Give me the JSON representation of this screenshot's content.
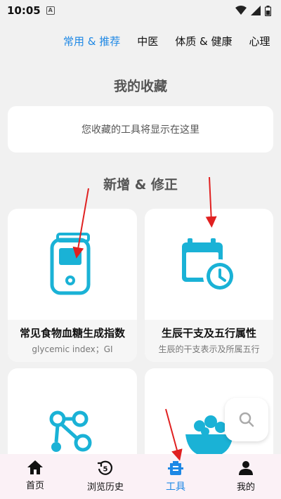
{
  "status_bar": {
    "time": "10:05",
    "a_badge": "A"
  },
  "tabs": [
    {
      "label": "常用 & 推荐",
      "active": true
    },
    {
      "label": "中医",
      "active": false
    },
    {
      "label": "体质 & 健康",
      "active": false
    },
    {
      "label": "心理",
      "active": false
    }
  ],
  "favorites": {
    "title": "我的收藏",
    "empty_text": "您收藏的工具将显示在这里"
  },
  "updates": {
    "title": "新增 & 修正",
    "cards": [
      {
        "title": "常见食物血糖生成指数",
        "subtitle": "glycemic index；GI",
        "icon": "glucose-meter-icon"
      },
      {
        "title": "生辰干支及五行属性",
        "subtitle": "生辰的干支表示及所属五行",
        "icon": "calendar-clock-icon"
      },
      {
        "title": "",
        "subtitle": "",
        "icon": "molecule-icon"
      },
      {
        "title": "",
        "subtitle": "",
        "icon": "salad-bowl-icon"
      }
    ]
  },
  "bottom_nav": [
    {
      "label": "首页",
      "icon": "home-icon"
    },
    {
      "label": "浏览历史",
      "icon": "history-icon"
    },
    {
      "label": "工具",
      "icon": "tools-icon",
      "active": true
    },
    {
      "label": "我的",
      "icon": "profile-icon"
    }
  ],
  "colors": {
    "accent": "#1e88e5",
    "icon_cyan": "#1ab2d6",
    "annotation": "#e02020"
  }
}
